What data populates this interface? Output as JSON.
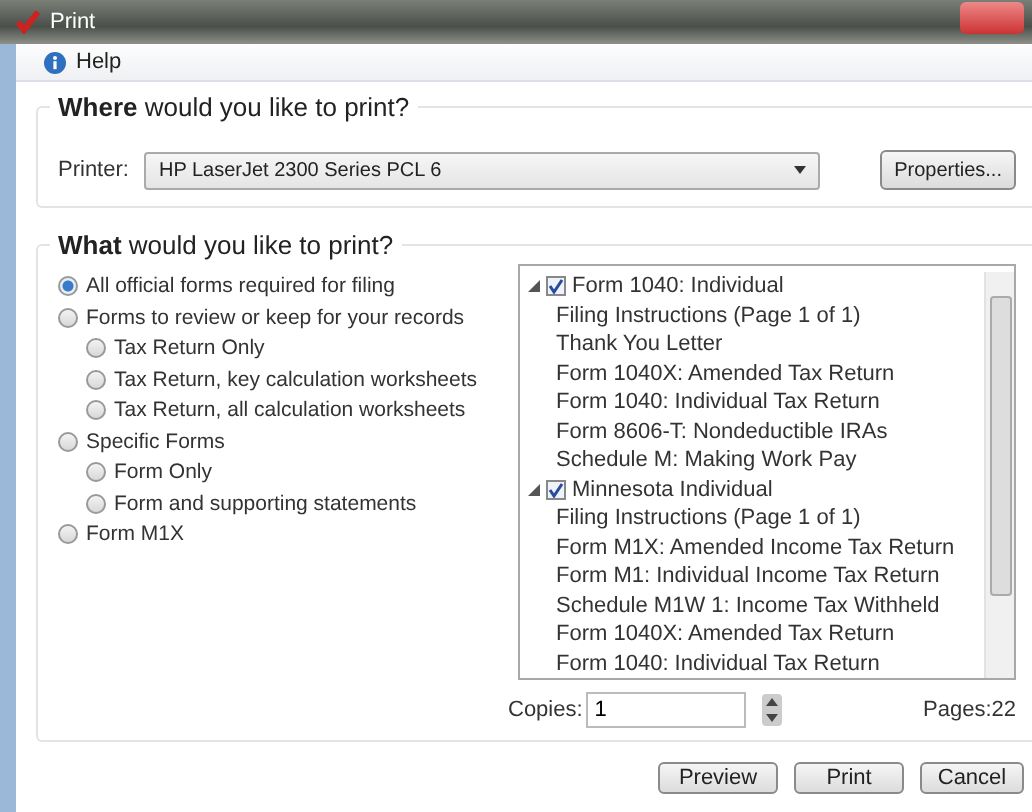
{
  "window": {
    "title": "Print"
  },
  "menu": {
    "help": "Help"
  },
  "where": {
    "heading": "**Where** would you like to print?",
    "printer_label": "Printer:",
    "printer": "HP LaserJet 2300 Series PCL 6",
    "properties": "Properties..."
  },
  "what": {
    "heading": "**What** would you like to print?",
    "options": [
      {
        "label": "All official forms required for filing",
        "selected": true
      },
      {
        "label": "Forms to review or keep for your records",
        "selected": false,
        "children": [
          {
            "label": "Tax Return Only",
            "selected": false
          },
          {
            "label": "Tax Return, key calculation worksheets",
            "selected": false
          },
          {
            "label": "Tax Return, all calculation worksheets",
            "selected": false
          }
        ]
      },
      {
        "label": "Specific Forms",
        "selected": false,
        "children": [
          {
            "label": "Form Only",
            "selected": false
          },
          {
            "label": "Form and supporting statements",
            "selected": false
          }
        ]
      },
      {
        "label": "Form M1X",
        "selected": false
      }
    ],
    "tree": [
      {
        "label": "Form 1040:  Individual",
        "checked": true,
        "expanded": true,
        "children": [
          "Filing Instructions (Page 1 of 1)",
          "Thank You Letter",
          "Form 1040X: Amended Tax Return",
          "Form 1040: Individual Tax Return",
          "Form 8606-T: Nondeductible IRAs",
          "Schedule M: Making Work Pay"
        ]
      },
      {
        "label": "Minnesota Individual",
        "checked": true,
        "expanded": true,
        "children": [
          "Filing Instructions (Page 1 of 1)",
          "Form M1X: Amended Income Tax Return",
          "Form M1: Individual Income Tax Return",
          "Schedule M1W 1: Income Tax Withheld",
          "Form 1040X: Amended Tax Return",
          "Form 1040: Individual Tax Return"
        ]
      }
    ],
    "copies_label": "Copies:",
    "copies": "1",
    "pages": "Pages:22"
  },
  "buttons": [
    "Preview",
    "Print",
    "Cancel"
  ]
}
